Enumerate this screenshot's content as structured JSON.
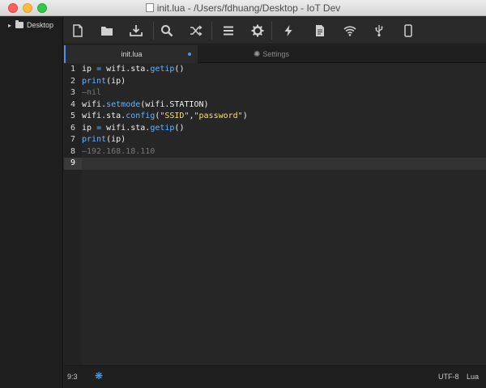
{
  "window": {
    "title": "init.lua - /Users/fdhuang/Desktop - IoT Dev"
  },
  "sidebar": {
    "root_folder": "Desktop"
  },
  "toolbar": {
    "buttons": [
      {
        "name": "new-file",
        "icon": "file-icon"
      },
      {
        "name": "open-folder",
        "icon": "folder-icon"
      },
      {
        "name": "download",
        "icon": "download-icon"
      },
      {
        "name": "search",
        "icon": "search-icon"
      },
      {
        "name": "shuffle",
        "icon": "shuffle-icon"
      },
      {
        "name": "list",
        "icon": "list-icon"
      },
      {
        "name": "settings",
        "icon": "gear-icon"
      },
      {
        "name": "flash",
        "icon": "lightning-icon"
      },
      {
        "name": "document",
        "icon": "document-icon"
      },
      {
        "name": "wifi",
        "icon": "wifi-icon"
      },
      {
        "name": "usb",
        "icon": "usb-icon"
      },
      {
        "name": "device",
        "icon": "phone-icon"
      }
    ]
  },
  "tabs": [
    {
      "label": "init.lua",
      "active": true,
      "modified": true
    },
    {
      "label": "Settings",
      "active": false
    }
  ],
  "editor": {
    "line_numbers": [
      "1",
      "2",
      "3",
      "4",
      "5",
      "6",
      "7",
      "8",
      "9"
    ],
    "current_line": 9,
    "lines": [
      "ip = wifi.sta.getip()",
      "print(ip)",
      "—nil",
      "wifi.setmode(wifi.STATION)",
      "wifi.sta.config(\"SSID\",\"password\")",
      "ip = wifi.sta.getip()",
      "print(ip)",
      "—192.168.18.110",
      ""
    ]
  },
  "statusbar": {
    "cursor": "9:3",
    "encoding": "UTF-8",
    "grammar": "Lua"
  },
  "colors": {
    "keyword": "#66b3ff",
    "string": "#f4e16b",
    "comment": "#777777",
    "accent": "#4d8ef0"
  }
}
